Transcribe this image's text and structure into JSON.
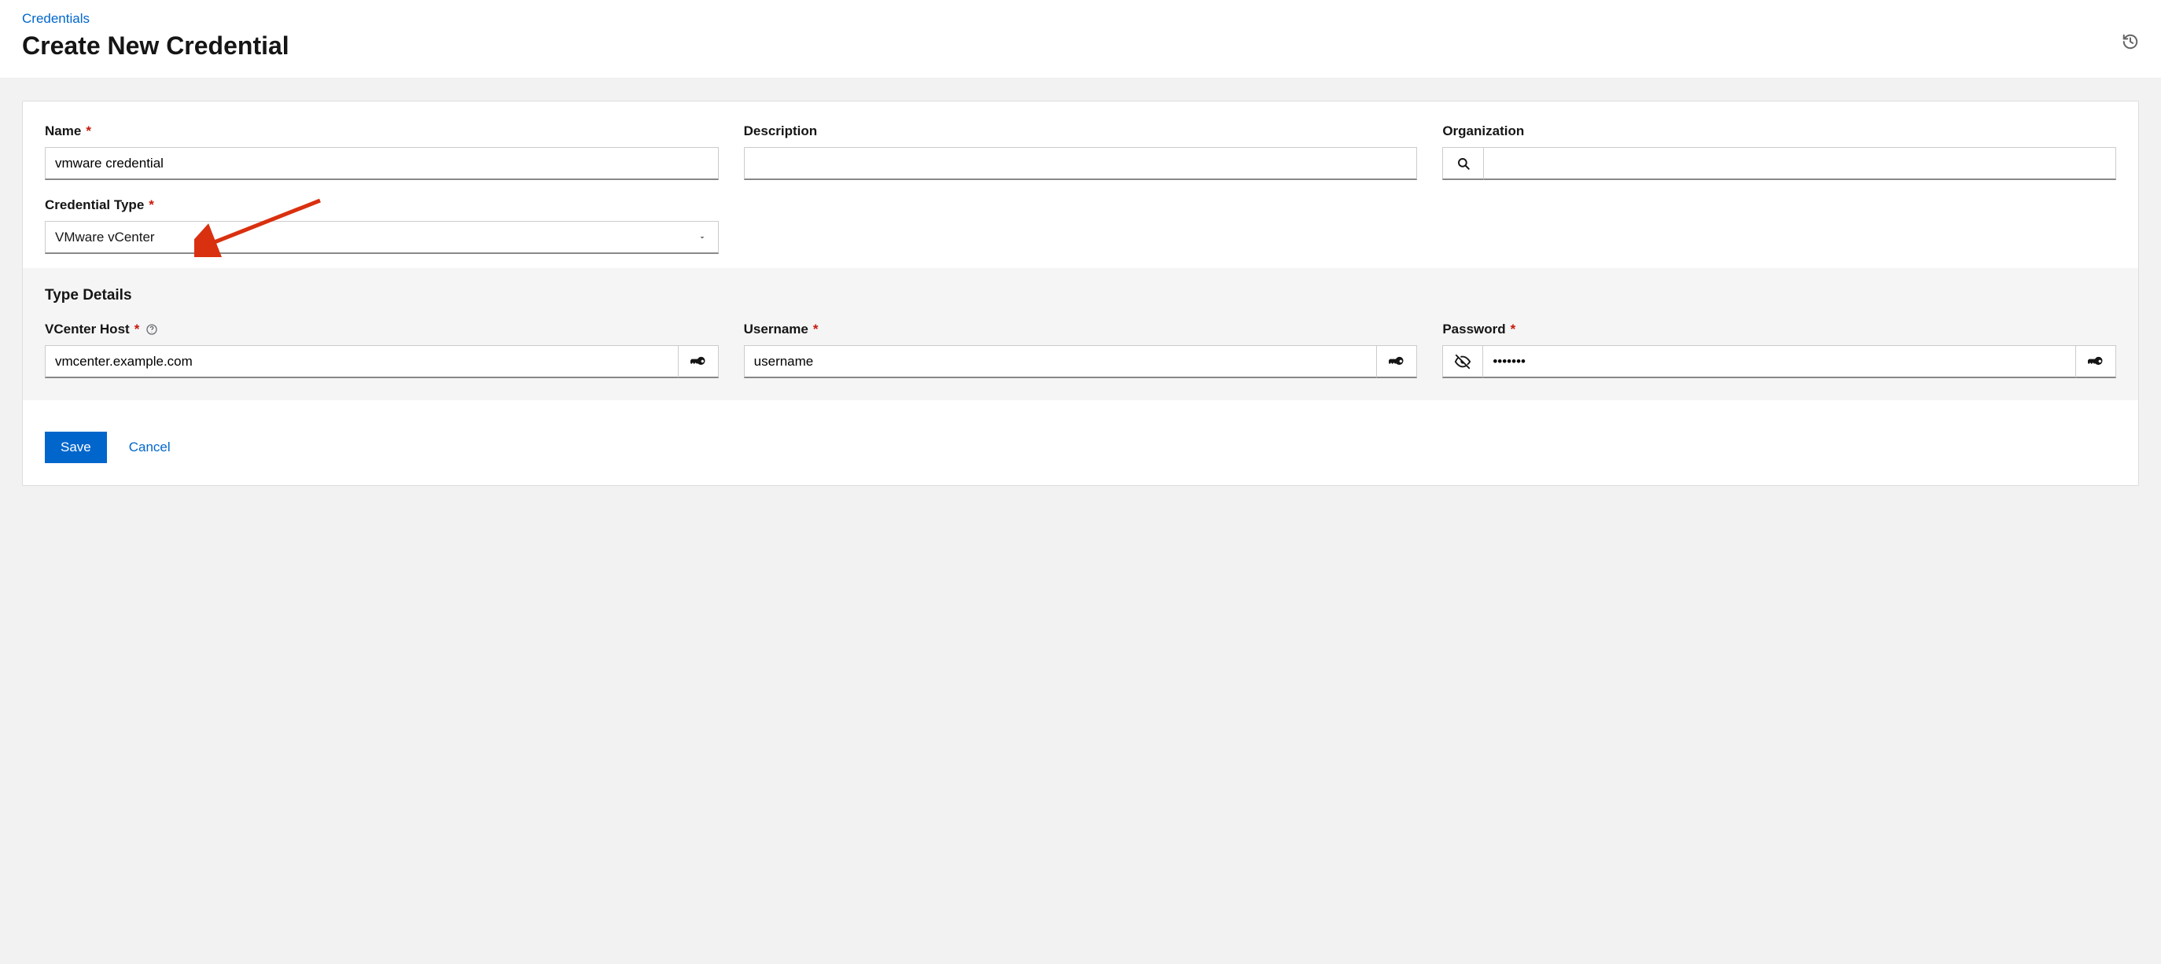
{
  "breadcrumb": {
    "label": "Credentials"
  },
  "page_title": "Create New Credential",
  "fields": {
    "name": {
      "label": "Name",
      "value": "vmware credential"
    },
    "description": {
      "label": "Description",
      "value": ""
    },
    "organization": {
      "label": "Organization",
      "value": ""
    },
    "credential_type": {
      "label": "Credential Type",
      "value": "VMware vCenter"
    }
  },
  "type_details": {
    "title": "Type Details",
    "vcenter_host": {
      "label": "VCenter Host",
      "value": "vmcenter.example.com"
    },
    "username": {
      "label": "Username",
      "value": "username"
    },
    "password": {
      "label": "Password",
      "value": "•••••••"
    }
  },
  "buttons": {
    "save": "Save",
    "cancel": "Cancel"
  }
}
